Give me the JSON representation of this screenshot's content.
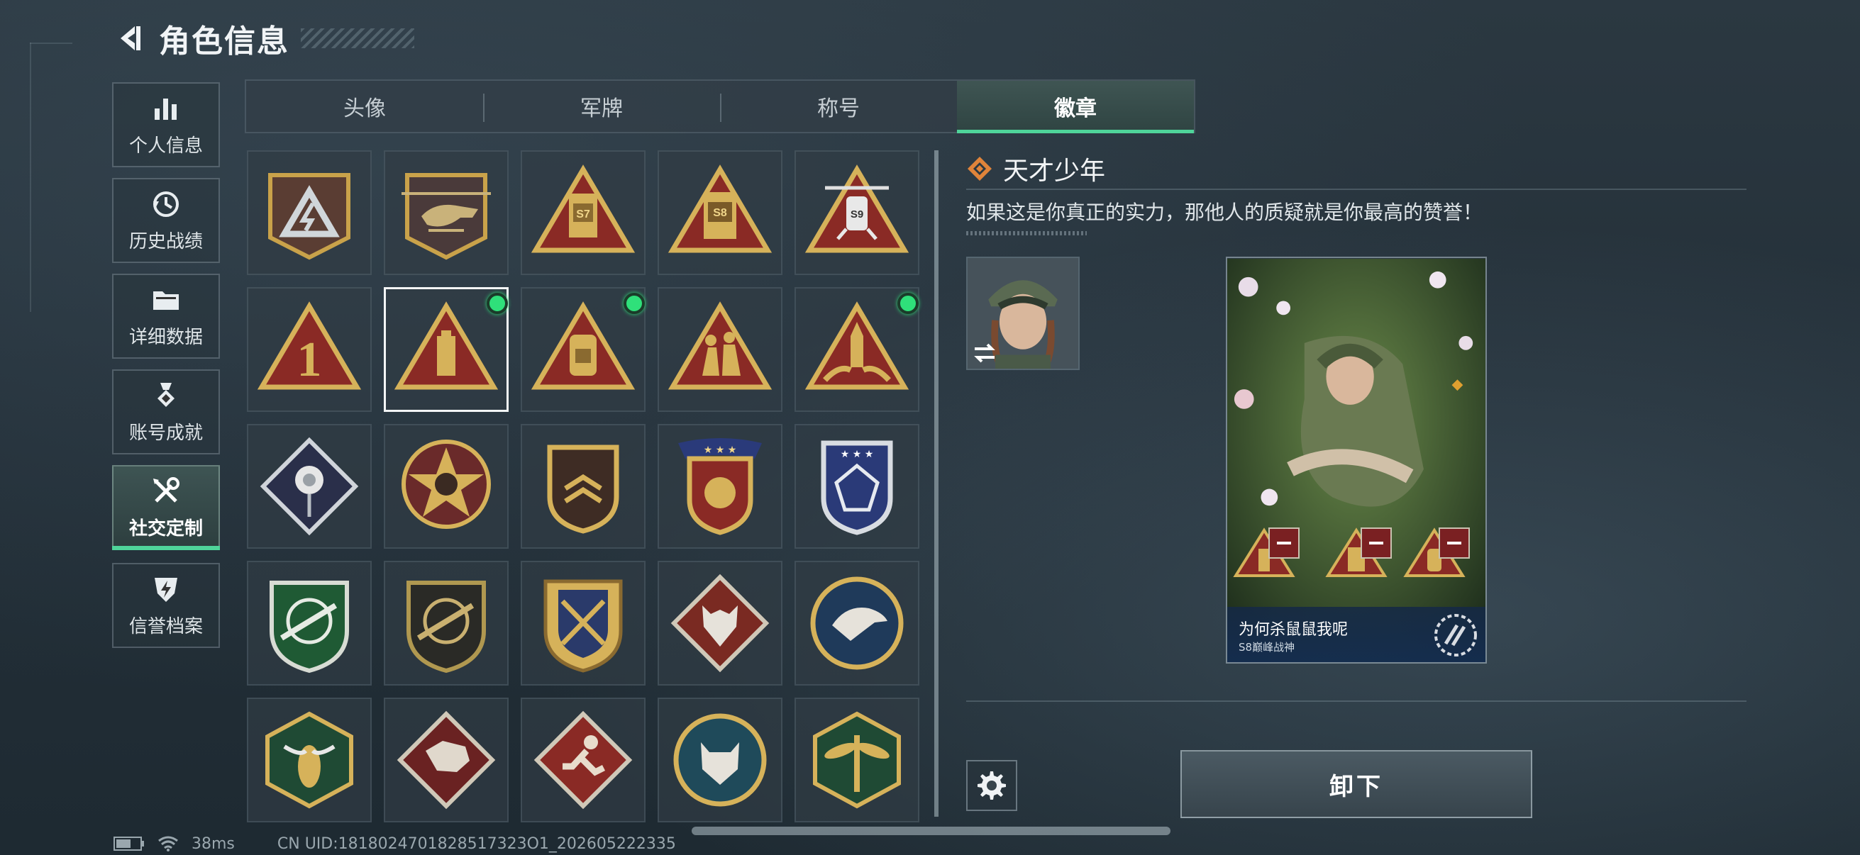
{
  "header": {
    "title": "角色信息"
  },
  "sidebar": {
    "items": [
      {
        "label": "个人信息",
        "icon": "bar-chart-icon"
      },
      {
        "label": "历史战绩",
        "icon": "history-clock-icon"
      },
      {
        "label": "详细数据",
        "icon": "folder-icon"
      },
      {
        "label": "账号成就",
        "icon": "medal-icon"
      },
      {
        "label": "社交定制",
        "icon": "tools-icon",
        "active": true
      },
      {
        "label": "信誉档案",
        "icon": "shield-lightning-icon"
      }
    ]
  },
  "tabs": [
    {
      "label": "头像"
    },
    {
      "label": "军牌"
    },
    {
      "label": "称号"
    },
    {
      "label": "徽章",
      "active": true
    }
  ],
  "badges": {
    "rows": [
      [
        "triangle-lightning-badge",
        "helicopter-badge",
        "season-s7-badge",
        "season-s8-badge",
        "season-s9-badge"
      ],
      [
        "rank-1-triangle-badge",
        "tower-triangle-badge",
        "backpack-triangle-badge",
        "soldiers-triangle-badge",
        "missile-triangle-badge"
      ],
      [
        "rose-diamond-badge",
        "skull-star-badge",
        "chevron-shield-badge",
        "crest-stars-badge",
        "blue-crystal-shield-badge"
      ],
      [
        "green-rifle-shield-badge",
        "black-rifle-shield-badge",
        "gold-crossed-rifles-badge",
        "wolf-diamond-badge",
        "eagle-round-badge"
      ],
      [
        "wasp-hexagon-badge",
        "dragon-diamond-badge",
        "runner-diamond-badge",
        "lynx-round-badge",
        "dragonfly-hexagon-badge"
      ]
    ],
    "selected": "tower-triangle-badge",
    "new_indicator": [
      "tower-triangle-badge",
      "backpack-triangle-badge",
      "missile-triangle-badge"
    ]
  },
  "detail": {
    "name": "天才少年",
    "description": "如果这是你真正的实力，那他人的质疑就是你最高的赞誉！",
    "card": {
      "name": "为何杀鼠鼠我呢",
      "subtitle": "S8巅峰战神"
    },
    "unequip_label": "卸下"
  },
  "status": {
    "ping": "38ms",
    "uid": "CN UID:1818024701828517323O1_202605222335"
  },
  "colors": {
    "accent": "#4fd49a",
    "gold": "#c9a24a",
    "badge_red": "#8a2a25",
    "new_dot": "#2fe07a"
  }
}
